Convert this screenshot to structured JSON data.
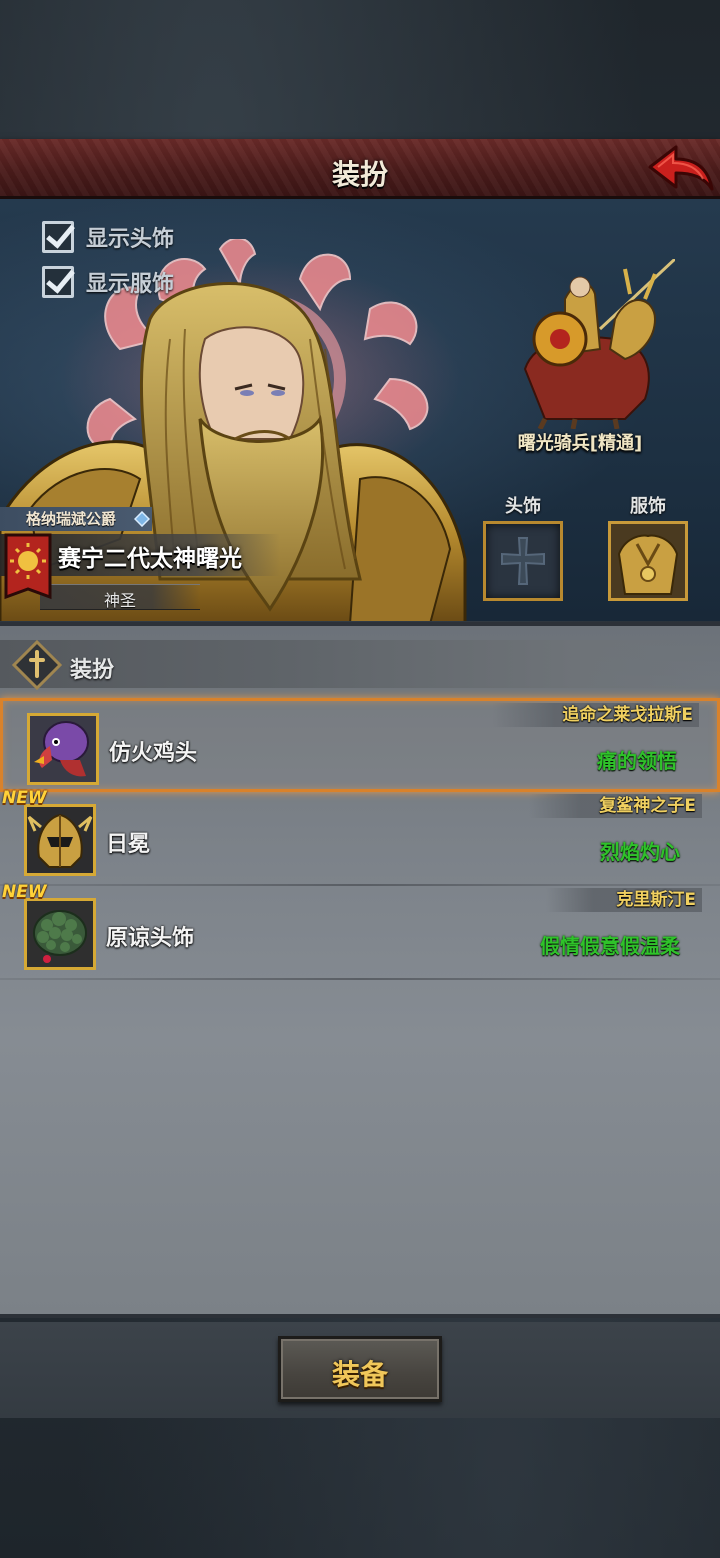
{
  "header": {
    "title": "装扮"
  },
  "toggles": [
    {
      "label": "显示头饰",
      "checked": true
    },
    {
      "label": "显示服饰",
      "checked": true
    }
  ],
  "hero": {
    "rank": "格纳瑞斌公爵",
    "name": "赛宁二代太神曙光",
    "tier": "神圣",
    "mount_name": "曙光骑兵[精通]"
  },
  "slots": {
    "head_label": "头饰",
    "outfit_label": "服饰"
  },
  "section": {
    "title": "装扮"
  },
  "items": [
    {
      "name": "仿火鸡头",
      "owner": "追命之莱戈拉斯E",
      "skill": "痛的领悟",
      "is_new": false,
      "selected": true,
      "icon": "turkey-head-icon"
    },
    {
      "name": "日冕",
      "owner": "复鲨神之子E",
      "skill": "烈焰灼心",
      "is_new": true,
      "selected": false,
      "icon": "golden-helmet-icon"
    },
    {
      "name": "原谅头饰",
      "owner": "克里斯汀E",
      "skill": "假情假意假温柔",
      "is_new": true,
      "selected": false,
      "icon": "green-hair-icon"
    }
  ],
  "new_badge": "NEW",
  "footer": {
    "equip_label": "装备"
  },
  "colors": {
    "title_bar": "#4b1c1b",
    "selected_border": "#d9822b",
    "skill_text": "#2fc22a",
    "owner_text": "#f0d060",
    "new_badge": "#ffd23a"
  }
}
